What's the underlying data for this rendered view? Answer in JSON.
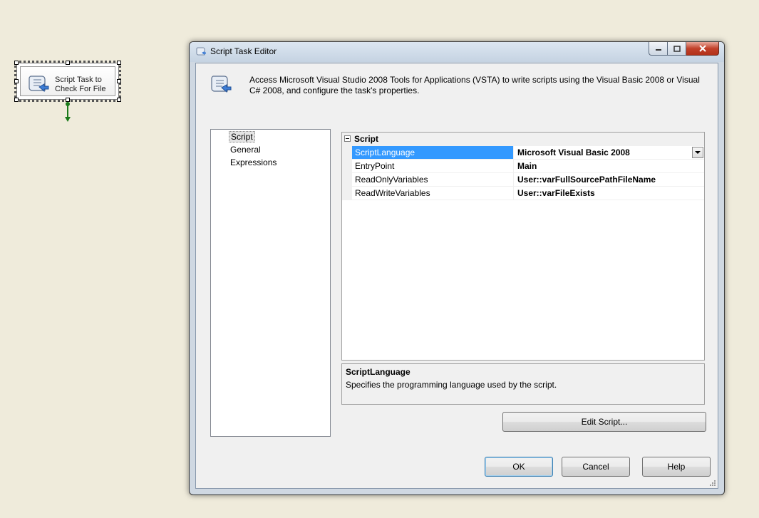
{
  "canvas": {
    "task": {
      "label": "Script Task to Check For File",
      "icon": "script-scroll-icon"
    },
    "connector_color": "#1a7a1a"
  },
  "window": {
    "title": "Script Task Editor",
    "controls": [
      "minimize",
      "maximize",
      "close"
    ]
  },
  "header": {
    "description": "Access Microsoft Visual Studio 2008 Tools for Applications (VSTA) to write scripts using the Visual Basic 2008 or Visual C# 2008, and configure the task's properties.",
    "icon": "script-scroll-icon"
  },
  "nav": {
    "items": [
      {
        "label": "Script",
        "selected": true
      },
      {
        "label": "General",
        "selected": false
      },
      {
        "label": "Expressions",
        "selected": false
      }
    ]
  },
  "grid": {
    "category": "Script",
    "rows": [
      {
        "name": "ScriptLanguage",
        "value": "Microsoft Visual Basic 2008",
        "selected": true
      },
      {
        "name": "EntryPoint",
        "value": "Main",
        "selected": false
      },
      {
        "name": "ReadOnlyVariables",
        "value": "User::varFullSourcePathFileName",
        "selected": false
      },
      {
        "name": "ReadWriteVariables",
        "value": "User::varFileExists",
        "selected": false
      }
    ]
  },
  "description": {
    "title": "ScriptLanguage",
    "text": "Specifies the programming language used by the script."
  },
  "buttons": {
    "edit_script": "Edit Script...",
    "ok": "OK",
    "cancel": "Cancel",
    "help": "Help"
  },
  "colors": {
    "selection": "#3399ff",
    "canvas_bg": "#efebdb",
    "dialog_bg": "#f0f0f0"
  }
}
